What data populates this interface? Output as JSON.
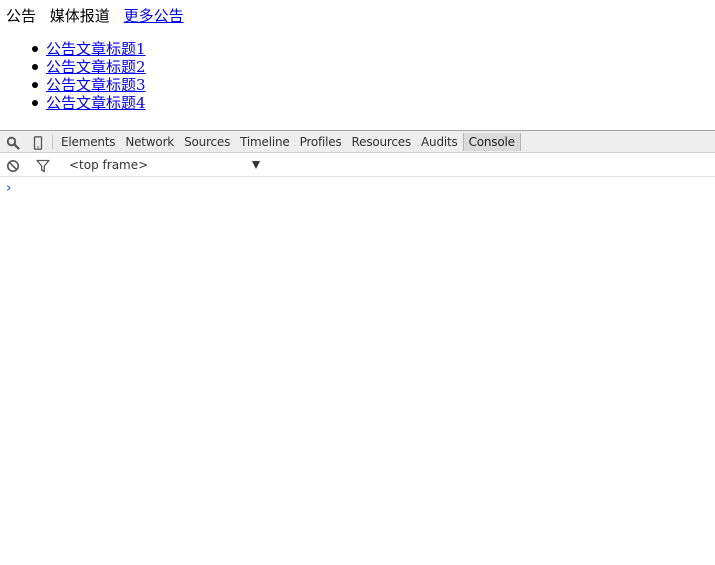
{
  "web": {
    "tabs": [
      {
        "label": "公告"
      },
      {
        "label": "媒体报道"
      }
    ],
    "more_link": "更多公告",
    "news_items": [
      {
        "label": "公告文章标题1"
      },
      {
        "label": "公告文章标题2"
      },
      {
        "label": "公告文章标题3"
      },
      {
        "label": "公告文章标题4"
      }
    ]
  },
  "devtools": {
    "icons": {
      "inspect": "search-icon",
      "device": "mobile-device-icon",
      "clear": "clear-console-icon",
      "filter": "filter-icon"
    },
    "tabs": [
      {
        "label": "Elements",
        "active": false
      },
      {
        "label": "Network",
        "active": false
      },
      {
        "label": "Sources",
        "active": false
      },
      {
        "label": "Timeline",
        "active": false
      },
      {
        "label": "Profiles",
        "active": false
      },
      {
        "label": "Resources",
        "active": false
      },
      {
        "label": "Audits",
        "active": false
      },
      {
        "label": "Console",
        "active": true
      }
    ],
    "frame_selector": "<top frame>",
    "prompt_symbol": "›",
    "colors": {
      "prompt": "#367cf1",
      "link": "#0000ee"
    }
  }
}
